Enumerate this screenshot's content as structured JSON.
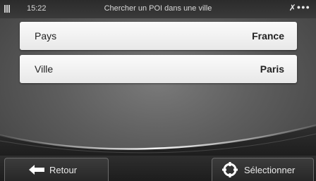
{
  "status": {
    "time": "15:22",
    "title": "Chercher un POI dans une ville"
  },
  "fields": [
    {
      "label": "Pays",
      "value": "France"
    },
    {
      "label": "Ville",
      "value": "Paris"
    }
  ],
  "buttons": {
    "back_label": "Retour",
    "select_label": "Sélectionner"
  },
  "colors": {
    "row_background": "#f4f4f4",
    "bar_background": "#262626",
    "road_highlight": "#ffffff"
  },
  "icons": {
    "back": "arrow-left-icon",
    "select": "target-icon",
    "status_left": "signal-bars-icon",
    "status_right": "satellite-icon"
  }
}
